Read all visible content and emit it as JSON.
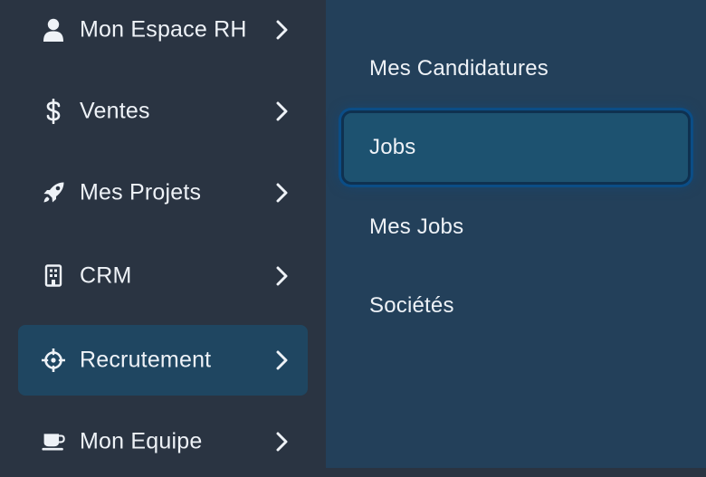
{
  "sidebar": {
    "items": [
      {
        "label": "Mon Espace RH",
        "icon": "user-icon"
      },
      {
        "label": "Ventes",
        "icon": "dollar-icon"
      },
      {
        "label": "Mes Projets",
        "icon": "rocket-icon"
      },
      {
        "label": "CRM",
        "icon": "building-icon"
      },
      {
        "label": "Recrutement",
        "icon": "crosshairs-icon",
        "active": true
      },
      {
        "label": "Mon Equipe",
        "icon": "coffee-icon"
      }
    ]
  },
  "submenu": {
    "items": [
      {
        "label": "Mes Candidatures"
      },
      {
        "label": "Jobs",
        "active": true
      },
      {
        "label": "Mes Jobs"
      },
      {
        "label": "Sociétés"
      }
    ]
  },
  "colors": {
    "sidebar_bg": "#2a3442",
    "submenu_bg": "#23405a",
    "active_bg": "#1f4661",
    "focus_ring": "#0b4d86",
    "text": "#eef2f7"
  }
}
